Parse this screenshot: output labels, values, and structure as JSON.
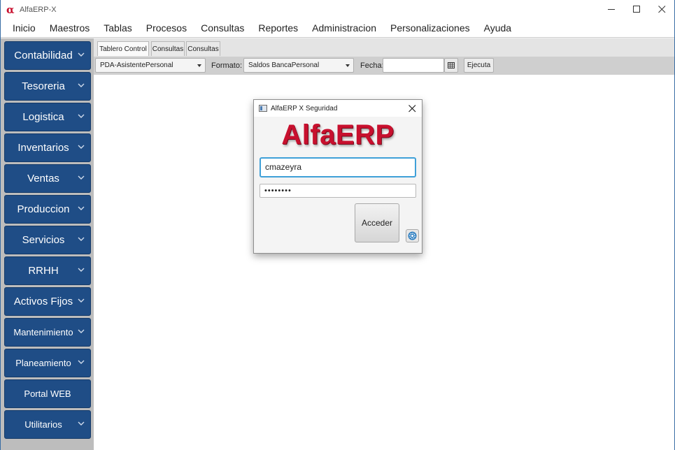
{
  "window": {
    "title": "AlfaERP-X",
    "logo_glyph": "α",
    "controls": {
      "minimize": "—",
      "maximize": "☐",
      "close": "✕"
    }
  },
  "menu": {
    "items": [
      "Inicio",
      "Maestros",
      "Tablas",
      "Procesos",
      "Consultas",
      "Reportes",
      "Administracion",
      "Personalizaciones",
      "Ayuda"
    ]
  },
  "sidebar": {
    "items": [
      {
        "label": "Contabilidad",
        "dropdown": true
      },
      {
        "label": "Tesoreria",
        "dropdown": true
      },
      {
        "label": "Logistica",
        "dropdown": true
      },
      {
        "label": "Inventarios",
        "dropdown": true
      },
      {
        "label": "Ventas",
        "dropdown": true
      },
      {
        "label": "Produccion",
        "dropdown": true
      },
      {
        "label": "Servicios",
        "dropdown": true
      },
      {
        "label": "RRHH",
        "dropdown": true
      },
      {
        "label": "Activos Fijos",
        "dropdown": true
      },
      {
        "label": "Mantenimiento",
        "dropdown": true
      },
      {
        "label": "Planeamiento",
        "dropdown": true
      },
      {
        "label": "Portal WEB",
        "dropdown": false
      },
      {
        "label": "Utilitarios",
        "dropdown": true
      }
    ],
    "button_color": "#1f4d86"
  },
  "tabs": [
    {
      "label": "Tablero Control",
      "active": true
    },
    {
      "label": "Consultas",
      "active": false
    },
    {
      "label": "Consultas",
      "active": false
    }
  ],
  "toolbar": {
    "report_select": "PDA-AsistentePersonal",
    "format_label": "Formato:",
    "format_select": "Saldos BancaPersonal",
    "date_label": "Fecha:",
    "date_value": "",
    "calendar_icon": "calendar-icon",
    "run_label": "Ejecuta"
  },
  "login_dialog": {
    "title": "AlfaERP X Seguridad",
    "brand": "AlfaERP",
    "username_value": "cmazeyra",
    "password_masked": "••••••••",
    "login_label": "Acceder",
    "settings_icon": "gear-icon",
    "brand_color": "#c8102e",
    "focus_color": "#3fa0d8"
  }
}
